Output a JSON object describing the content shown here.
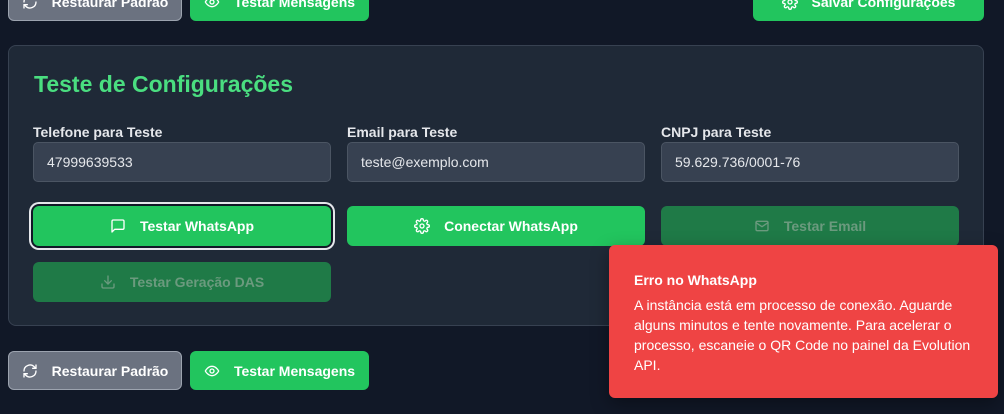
{
  "top_actions": {
    "reset_label": "Restaurar Padrão",
    "test_messages_label": "Testar Mensagens",
    "save_label": "Salvar Configurações"
  },
  "test_section": {
    "title": "Teste de Configurações",
    "phone": {
      "label": "Telefone para Teste",
      "value": "47999639533"
    },
    "email": {
      "label": "Email para Teste",
      "value": "teste@exemplo.com"
    },
    "cnpj": {
      "label": "CNPJ para Teste",
      "value": "59.629.736/0001-76"
    },
    "buttons": {
      "test_whatsapp": "Testar WhatsApp",
      "connect_whatsapp": "Conectar WhatsApp",
      "test_email": "Testar Email",
      "test_das": "Testar Geração DAS"
    }
  },
  "bottom_actions": {
    "reset_label": "Restaurar Padrão",
    "test_messages_label": "Testar Mensagens"
  },
  "toast": {
    "title": "Erro no WhatsApp",
    "message": "A instância está em processo de conexão. Aguarde alguns minutos e tente novamente. Para acelerar o processo, escaneie o QR Code no painel da Evolution API."
  },
  "colors": {
    "background": "#111827",
    "card": "#1f2937",
    "accent_green": "#22c55e",
    "title_green": "#4ade80",
    "error_red": "#ef4444"
  }
}
